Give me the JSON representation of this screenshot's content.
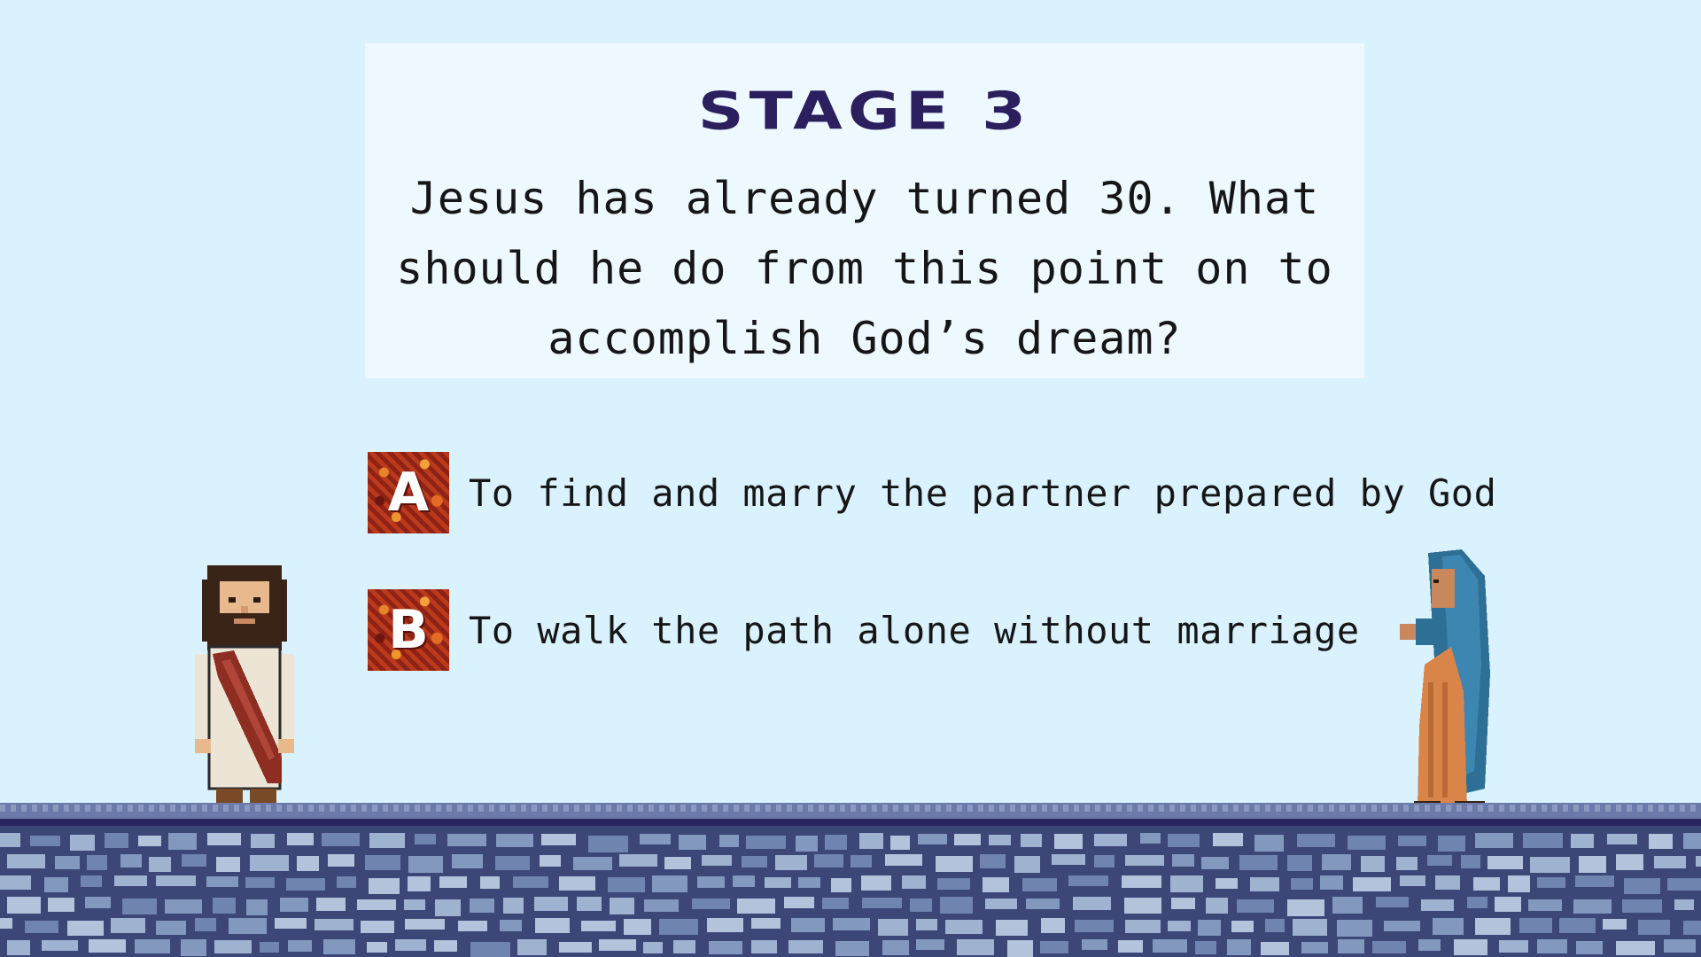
{
  "stage": {
    "title": "STAGE 3",
    "question": "Jesus has already turned 30. What should he do from this point on to accomplish God’s dream?"
  },
  "answers": [
    {
      "letter": "A",
      "text": "To find and marry the partner prepared by God"
    },
    {
      "letter": "B",
      "text": "To walk the path alone without marriage"
    }
  ],
  "characters": {
    "left": "jesus-sprite",
    "right": "mary-sprite"
  },
  "colors": {
    "background": "#d9f2fd",
    "card": "#eef8ff",
    "title": "#2c1f5e",
    "badge": "#a8301c",
    "ground_dark": "#3c4677",
    "ground_light": "#9fb3d1"
  }
}
